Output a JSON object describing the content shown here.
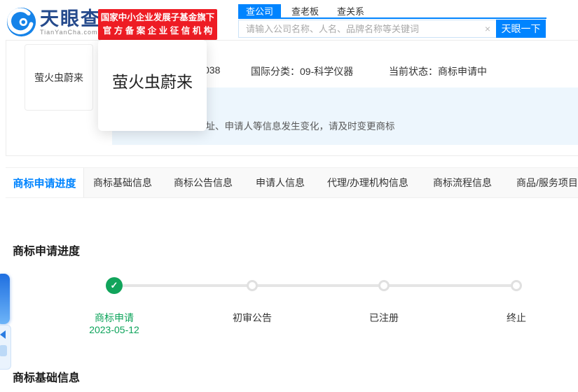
{
  "brand": {
    "logo_title": "天眼查",
    "logo_subtitle": "TianYanCha.com",
    "badge_line1": "国家中小企业发展子基金旗下",
    "badge_line2": "官方备案企业征信机构"
  },
  "search": {
    "tabs": [
      {
        "label": "查公司",
        "active": true
      },
      {
        "label": "查老板",
        "active": false
      },
      {
        "label": "查关系",
        "active": false
      }
    ],
    "placeholder": "请输入公司名称、人名、品牌名称等关键词",
    "clear_icon": "×",
    "button_label": "天眼一下"
  },
  "trademark": {
    "thumb_name": "萤火虫蔚来",
    "popup_name": "萤火虫蔚来",
    "reg_no_visible": "038",
    "intl_class": "国际分类：09-科学仪器",
    "current_status": "当前状态：商标申请中",
    "notice": "地址、申请人等信息发生变化，请及时变更商标"
  },
  "tabs": [
    {
      "label": "商标申请进度",
      "active": true
    },
    {
      "label": "商标基础信息",
      "active": false
    },
    {
      "label": "商标公告信息",
      "active": false
    },
    {
      "label": "申请人信息",
      "active": false
    },
    {
      "label": "代理/办理机构信息",
      "active": false
    },
    {
      "label": "商标流程信息",
      "active": false
    },
    {
      "label": "商品/服务项目",
      "active": false
    }
  ],
  "progress": {
    "title": "商标申请进度",
    "check_icon": "✓",
    "steps": [
      {
        "label": "商标申请",
        "date": "2023-05-12",
        "state": "done"
      },
      {
        "label": "初审公告",
        "state": "pending"
      },
      {
        "label": "已注册",
        "state": "pending"
      },
      {
        "label": "终止",
        "state": "pending"
      }
    ]
  },
  "sections": {
    "basic_info_title": "商标基础信息"
  },
  "colors": {
    "brand_blue": "#0084ff",
    "logo_navy": "#254a8c",
    "badge_red": "#ee1c24",
    "done_green": "#11a45b",
    "notice_bg": "#edf6fd",
    "track_gray": "#e5e5e5"
  }
}
